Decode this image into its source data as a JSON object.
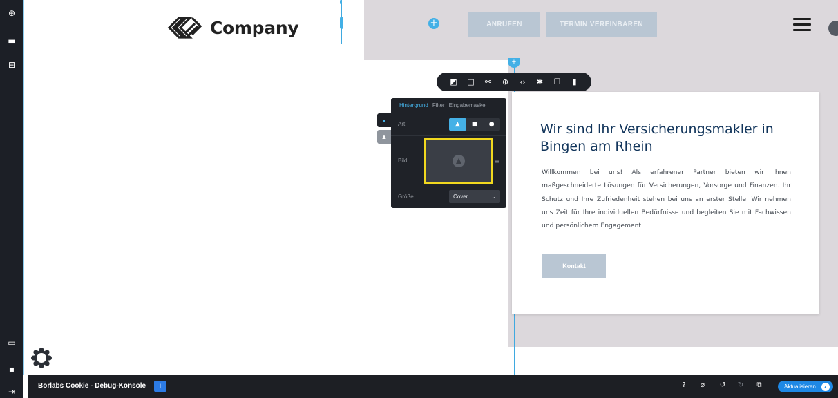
{
  "header": {
    "logo_text": "Company",
    "call_button_label": "ANRUFEN",
    "appointment_button_label": "TERMIN VEREINBAREN"
  },
  "left_toolbar": {
    "items": [
      {
        "icon": "add-circle-icon"
      },
      {
        "icon": "layers-icon"
      },
      {
        "icon": "layout-icon"
      },
      {
        "icon": "desktop-icon"
      },
      {
        "icon": "page-icon"
      },
      {
        "icon": "exit-icon"
      }
    ]
  },
  "element_toolbar": {
    "icons": [
      "background-icon",
      "frame-icon",
      "link-icon",
      "add-icon",
      "code-icon",
      "settings-icon",
      "copy-icon",
      "delete-icon"
    ]
  },
  "settings_panel": {
    "tabs": [
      "Hintergrund",
      "Filter",
      "Eingabemaske"
    ],
    "active_tab": "Hintergrund",
    "art_label": "Art",
    "bild_label": "Bild",
    "size_label": "Größe",
    "size_value": "Cover"
  },
  "card": {
    "title": "Wir sind Ihr Versicherungsmakler in Bingen am Rhein",
    "body": "Willkommen bei uns! Als erfahrener Partner bieten wir Ihnen maßgeschneiderte Lösungen für Versicherungen, Vorsorge und Finanzen. Ihr Schutz und Ihre Zufriedenheit stehen bei uns an erster Stelle. Wir nehmen uns Zeit für Ihre individuellen Bedürfnisse und begleiten Sie mit Fachwissen und persönlichem Engagement.",
    "button_label": "Kontakt"
  },
  "bottom_bar": {
    "title": "Borlabs Cookie - Debug-Konsole",
    "plus_label": "+",
    "update_label": "Aktualisieren"
  },
  "colors": {
    "accent": "#43b0e6",
    "title_blue": "#12355b",
    "button_gray_blue": "#b9c6d3",
    "highlight_yellow": "#f1d81f"
  }
}
